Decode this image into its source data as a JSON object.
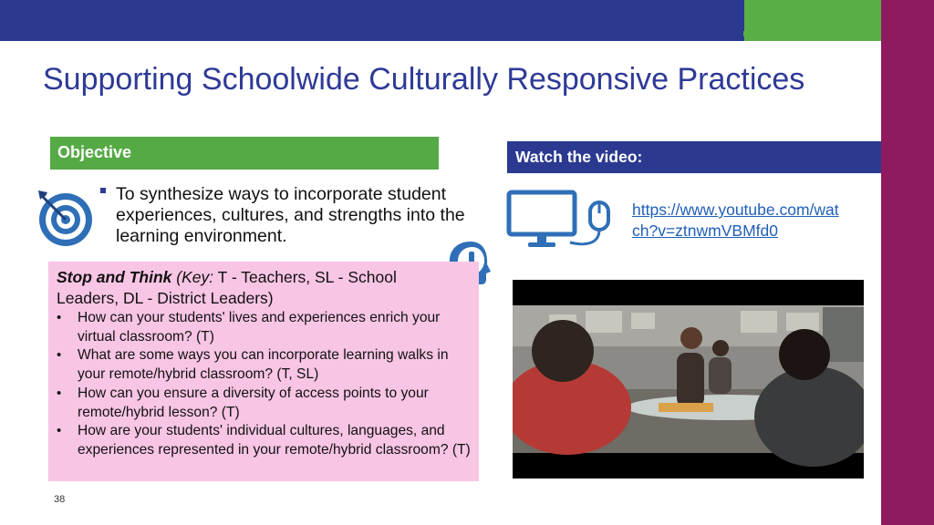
{
  "slide": {
    "title": "Supporting Schoolwide Culturally Responsive Practices",
    "number": "38"
  },
  "objective": {
    "heading": "Objective",
    "text": "To synthesize ways to incorporate student experiences, cultures, and strengths into the learning environment."
  },
  "stop_and_think": {
    "label": "Stop and Think",
    "key_label": "(Key:",
    "key_text": "T - Teachers, SL - School Leaders, DL - District Leaders)",
    "questions": [
      "How can your students' lives and experiences enrich your virtual classroom? (T)",
      "What are some ways you can incorporate learning walks in your remote/hybrid classroom? (T, SL)",
      "How can you ensure a diversity of access points to your remote/hybrid lesson? (T)",
      "How are your students' individual cultures, languages, and experiences represented in your remote/hybrid classroom? (T)"
    ]
  },
  "video": {
    "heading": "Watch the video:",
    "link": "https://www.youtube.com/watch?v=ztnwmVBMfd0"
  },
  "colors": {
    "navy": "#2b3990",
    "green": "#55aa45",
    "magenta": "#8e1b5f",
    "pink_box": "#f8c5e4",
    "link": "#1f5fb8"
  },
  "icons": [
    "target-icon",
    "head-exclamation-icon",
    "computer-mouse-icon"
  ]
}
